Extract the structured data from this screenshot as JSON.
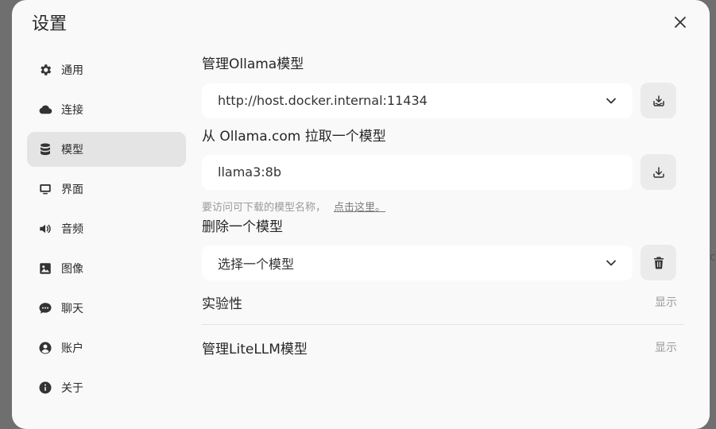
{
  "dialog": {
    "title": "设置"
  },
  "sidebar": {
    "items": [
      {
        "label": "通用",
        "icon": "gear-icon"
      },
      {
        "label": "连接",
        "icon": "cloud-icon"
      },
      {
        "label": "模型",
        "icon": "database-icon",
        "active": true
      },
      {
        "label": "界面",
        "icon": "monitor-icon"
      },
      {
        "label": "音频",
        "icon": "speaker-icon"
      },
      {
        "label": "图像",
        "icon": "image-icon"
      },
      {
        "label": "聊天",
        "icon": "chat-icon"
      },
      {
        "label": "账户",
        "icon": "user-icon"
      },
      {
        "label": "关于",
        "icon": "info-icon"
      }
    ]
  },
  "main": {
    "manage_ollama": {
      "label": "管理Ollama模型",
      "selected_host": "http://host.docker.internal:11434"
    },
    "pull_model": {
      "label": "从 Ollama.com 拉取一个模型",
      "value": "llama3:8b",
      "hint": "要访问可下载的模型名称，",
      "hint_link": "点击这里。"
    },
    "delete_model": {
      "label": "删除一个模型",
      "placeholder": "选择一个模型"
    },
    "experimental": {
      "label": "实验性",
      "toggle": "显示"
    },
    "litellm": {
      "label": "管理LiteLLM模型",
      "toggle": "显示"
    }
  },
  "edge_text": "c"
}
